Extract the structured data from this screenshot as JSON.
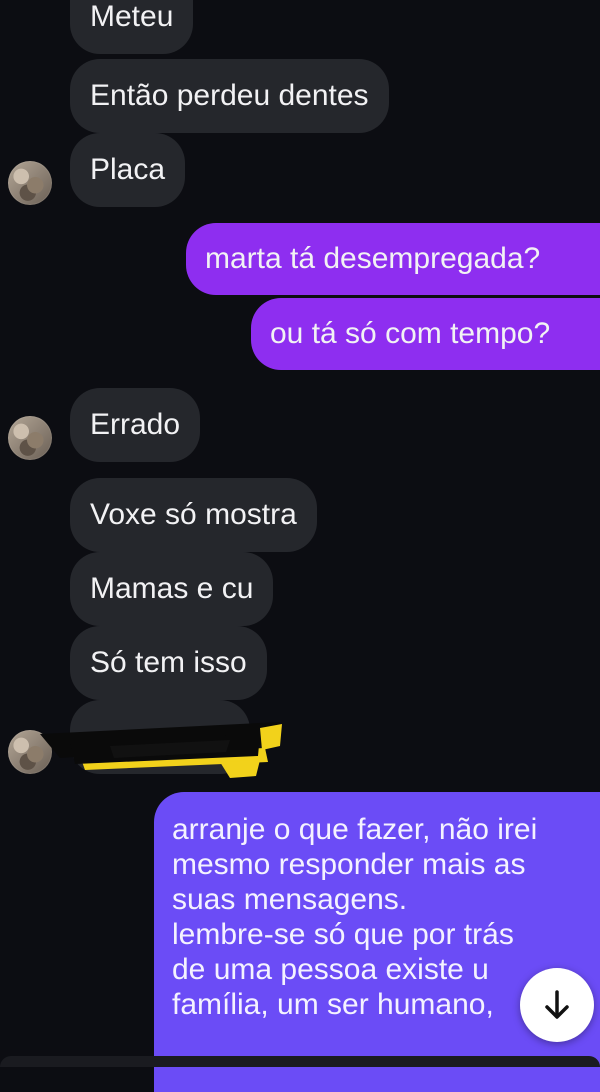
{
  "messages": {
    "m1": "Meteu",
    "m2": "Então perdeu dentes",
    "m3": "Placa",
    "m4": "marta tá desempregada?",
    "m5": "ou tá só com tempo?",
    "m6": "Errado",
    "m7": "Voxe só mostra",
    "m8": "Mamas e cu",
    "m9": "Só tem isso",
    "m10": {
      "line1": "arranje o que fazer, não irei",
      "line2": "mesmo responder mais as",
      "line3": "suas mensagens.",
      "line4": "lembre-se só que por trás",
      "line5": "de uma pessoa existe u",
      "line6": "família, um ser humano,"
    }
  },
  "colors": {
    "background": "#0c0d12",
    "incoming_bubble": "#25272c",
    "outgoing_bubble": "#8e2ef0",
    "outgoing_bubble_latest": "#6b4cf6"
  },
  "icons": {
    "scroll_down": "arrow-down-icon"
  }
}
